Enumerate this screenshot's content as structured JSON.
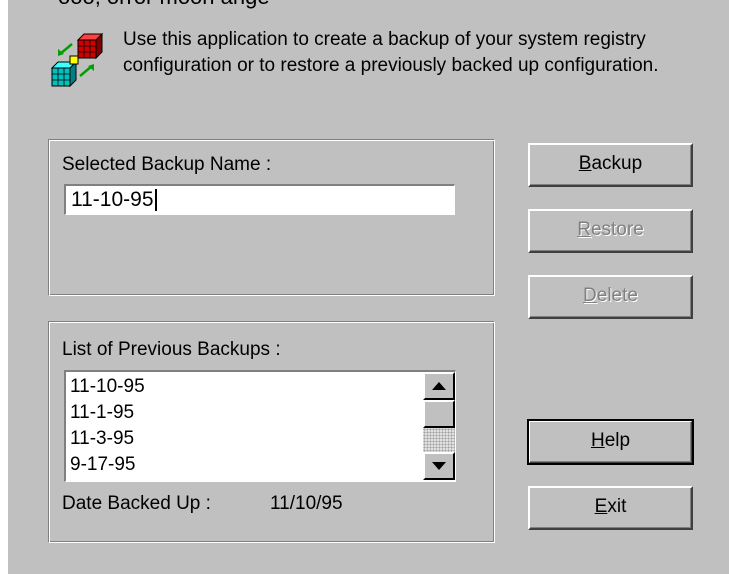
{
  "header": {
    "partial_text": "ooo, orror moon ange",
    "intro_line1": "Use this application to create a backup of your system registry",
    "intro_line2": "configuration or to restore a previously backed up configuration."
  },
  "selected": {
    "label": "Selected Backup Name :",
    "value": "11-10-95"
  },
  "previous": {
    "label": "List of Previous Backups :",
    "items": [
      "11-10-95",
      "11-1-95",
      "11-3-95",
      "9-17-95"
    ],
    "date_label": "Date Backed Up :",
    "date_value": "11/10/95"
  },
  "buttons": {
    "backup": {
      "acc": "B",
      "rest": "ackup",
      "enabled": true
    },
    "restore": {
      "acc": "R",
      "rest": "estore",
      "enabled": false
    },
    "delete": {
      "acc": "D",
      "rest": "elete",
      "enabled": false
    },
    "help": {
      "acc": "H",
      "rest": "elp",
      "enabled": true
    },
    "exit": {
      "acc": "E",
      "rest": "xit",
      "enabled": true
    }
  },
  "scrollbar": {
    "up_icon": "triangle-up-icon",
    "down_icon": "triangle-down-icon"
  },
  "colors": {
    "dialog_face": "#c0c0c0",
    "disabled_text": "#808080"
  }
}
